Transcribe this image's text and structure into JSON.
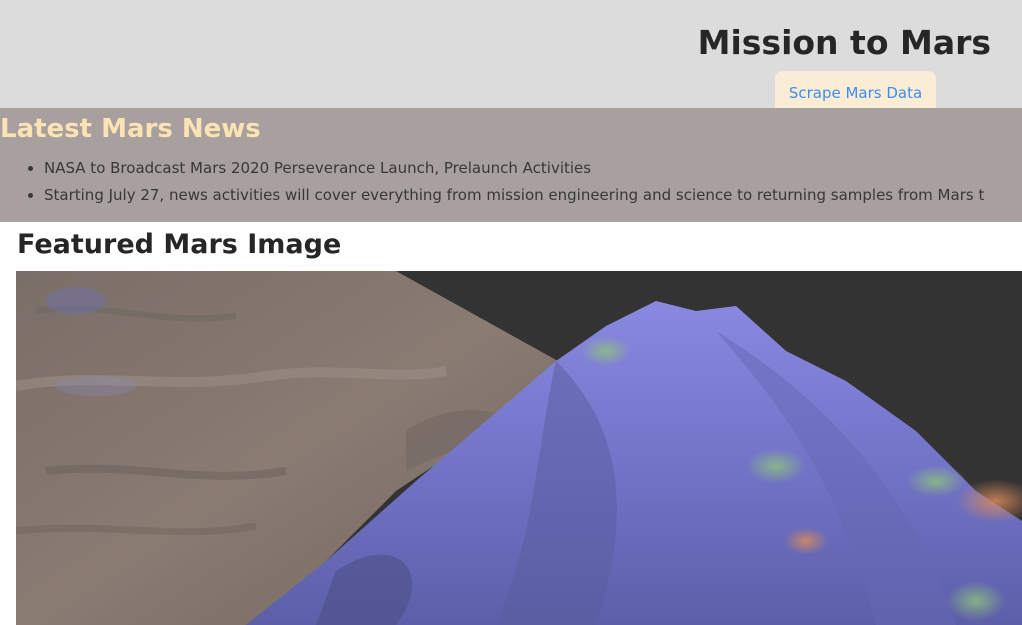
{
  "header": {
    "title": "Mission to Mars",
    "scrape_button_label": "Scrape Mars Data"
  },
  "news": {
    "heading": "Latest Mars News",
    "items": [
      "NASA to Broadcast Mars 2020 Perseverance Launch, Prelaunch Activities",
      "Starting July 27, news activities will cover everything from mission engineering and science to returning samples from Mars t"
    ]
  },
  "featured": {
    "heading": "Featured Mars Image",
    "image_icon": "mars-terrain-image"
  },
  "colors": {
    "header_bg": "#dcdcdc",
    "news_bg": "#a89f9f",
    "news_heading": "#fbe3b3",
    "button_bg": "#fbecd6",
    "button_text": "#3b8df0"
  }
}
